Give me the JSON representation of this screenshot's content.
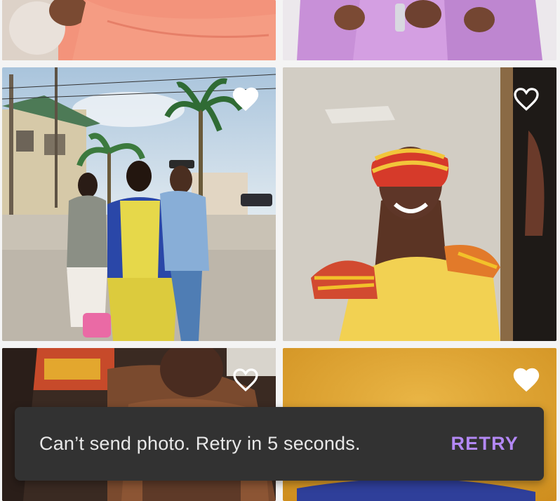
{
  "gallery": {
    "tiles": [
      {
        "name": "top-left-photo",
        "favorited": false
      },
      {
        "name": "top-right-photo",
        "favorited": false
      },
      {
        "name": "street-photo",
        "favorited": true
      },
      {
        "name": "smiling-woman-photo",
        "favorited": false
      },
      {
        "name": "car-interior-photo",
        "favorited": false
      },
      {
        "name": "gold-background-photo",
        "favorited": true
      }
    ],
    "icons": {
      "favorite": "heart-icon",
      "favorite_outline": "heart-outline-icon"
    }
  },
  "snackbar": {
    "message": "Can’t send photo. Retry in 5 seconds.",
    "action_label": "RETRY",
    "background": "#323232",
    "action_color": "#b388f5"
  }
}
